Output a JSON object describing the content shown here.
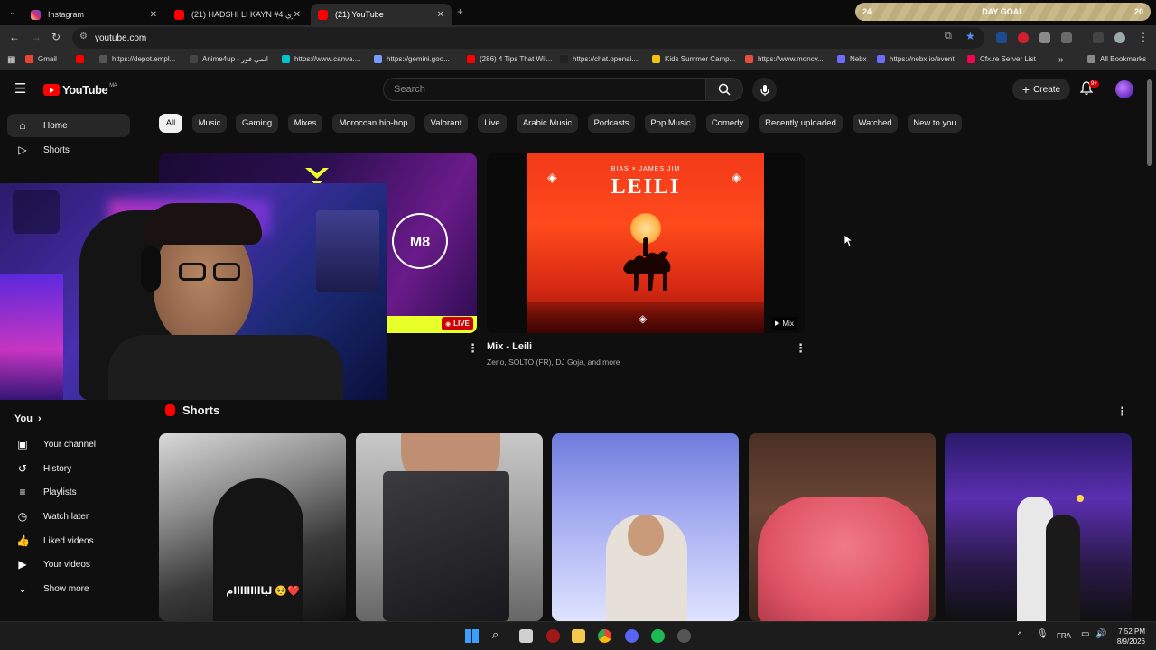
{
  "browser": {
    "tabs": [
      {
        "title": "Instagram",
        "color": "#d6249f"
      },
      {
        "title": "(21) HADSHI LI KAYN #4 ديميتري",
        "color": "#ff0000"
      },
      {
        "title": "(21) YouTube",
        "color": "#ff0000"
      }
    ],
    "new_tab": "+",
    "goal": {
      "left": "24",
      "label": "DAY GOAL",
      "right": "20"
    },
    "url": "youtube.com",
    "bookmarks": [
      {
        "label": "Gmail",
        "color": "#ea4335"
      },
      {
        "label": "",
        "color": "#ff0000"
      },
      {
        "label": "https://depot.empl...",
        "color": "#555555"
      },
      {
        "label": "Anime4up - انمي فور",
        "color": "#444444"
      },
      {
        "label": "https://www.canva....",
        "color": "#00c4cc"
      },
      {
        "label": "https://gemini.goo...",
        "color": "#7b9cff"
      },
      {
        "label": "(286) 4 Tips That Wil...",
        "color": "#ff0000"
      },
      {
        "label": "https://chat.openai....",
        "color": "#222222"
      },
      {
        "label": "Kids Summer Camp...",
        "color": "#f4c20d"
      },
      {
        "label": "https://www.moncv...",
        "color": "#e84c3d"
      },
      {
        "label": "Nebx",
        "color": "#6d6dff"
      },
      {
        "label": "https://nebx.io/event",
        "color": "#6d6dff"
      },
      {
        "label": "Cfx.re Server List",
        "color": "#f40552"
      }
    ],
    "more_bookmarks": "»",
    "all_bookmarks": "All Bookmarks"
  },
  "header": {
    "logo_text": "YouTube",
    "region": "MA",
    "search_placeholder": "Search",
    "create_label": "Create",
    "notification_count": "9+"
  },
  "sidebar": {
    "top": [
      {
        "label": "Home",
        "icon": "home-icon"
      },
      {
        "label": "Shorts",
        "icon": "shorts-icon"
      }
    ],
    "you_label": "You",
    "you_items": [
      {
        "label": "Your channel",
        "icon": "channel-icon"
      },
      {
        "label": "History",
        "icon": "history-icon"
      },
      {
        "label": "Playlists",
        "icon": "playlists-icon"
      },
      {
        "label": "Watch later",
        "icon": "watch-later-icon"
      },
      {
        "label": "Liked videos",
        "icon": "liked-icon"
      },
      {
        "label": "Your videos",
        "icon": "your-videos-icon"
      },
      {
        "label": "Show more",
        "icon": "chevron-down-icon"
      }
    ]
  },
  "chips": [
    "All",
    "Music",
    "Gaming",
    "Mixes",
    "Moroccan hip-hop",
    "Valorant",
    "Live",
    "Arabic Music",
    "Podcasts",
    "Pop Music",
    "Comedy",
    "Recently uploaded",
    "Watched",
    "New to you"
  ],
  "videos": [
    {
      "badge": "LIVE"
    },
    {
      "title": "Mix - Leili",
      "subtitle": "Zeno, SOLTO (FR), DJ Goja, and more",
      "badge": "Mix",
      "art_top": "BIAS × JAMES JIM",
      "art_title": "LEILI"
    }
  ],
  "shorts": {
    "heading": "Shorts",
    "first_caption": "ليااااااااام 🥺❤️"
  },
  "taskbar": {
    "lang": "FRA",
    "time": "7:52 PM",
    "date": "8/9/2026"
  }
}
